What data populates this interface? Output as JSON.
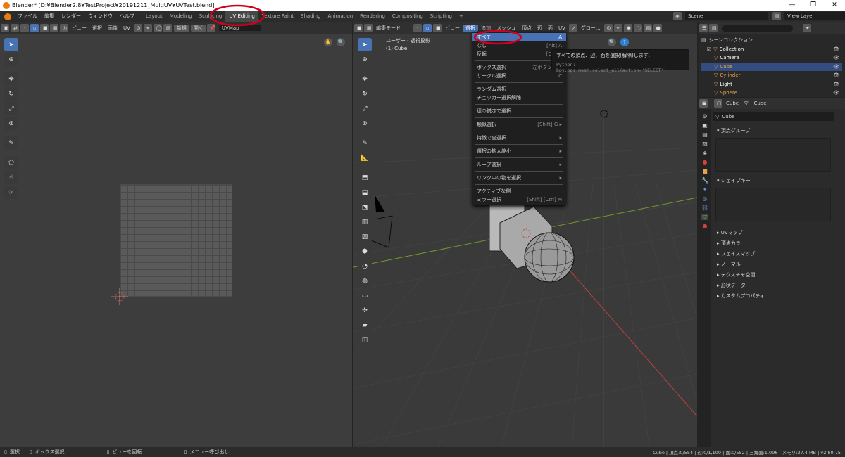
{
  "titlebar": {
    "title": "Blender* [D:¥Blender2.8¥TestProject¥20191211_MultiUV¥UVTest.blend]",
    "minimize": "—",
    "maximize": "❐",
    "close": "✕"
  },
  "top_menu": [
    "ファイル",
    "編集",
    "レンダー",
    "ウィンドウ",
    "ヘルプ"
  ],
  "workspaces": [
    {
      "label": "Layout",
      "active": false
    },
    {
      "label": "Modeling",
      "active": false
    },
    {
      "label": "Sculpting",
      "active": false
    },
    {
      "label": "UV Editing",
      "active": true
    },
    {
      "label": "Texture Paint",
      "active": false
    },
    {
      "label": "Shading",
      "active": false
    },
    {
      "label": "Animation",
      "active": false
    },
    {
      "label": "Rendering",
      "active": false
    },
    {
      "label": "Compositing",
      "active": false
    },
    {
      "label": "Scripting",
      "active": false
    }
  ],
  "add_workspace": "+",
  "scene": {
    "scene_label": "Scene",
    "view_layer_label": "View Layer"
  },
  "uv_editor": {
    "menus": [
      "ビュー",
      "選択",
      "画像",
      "UV"
    ],
    "new_label": "新規",
    "open_label": "開く",
    "uvmap": "UVMap"
  },
  "viewport": {
    "mode": "編集モード",
    "menus": [
      "ビュー",
      "選択",
      "追加",
      "メッシュ",
      "頂点",
      "辺",
      "面",
      "UV"
    ],
    "orientation": "グロー...",
    "view_label": "ユーザー・透視投影",
    "object_label": "(1) Cube"
  },
  "select_menu": {
    "items": [
      {
        "label": "すべて",
        "shortcut": "A",
        "highlight": true
      },
      {
        "label": "なし",
        "shortcut": "[Alt] A"
      },
      {
        "label": "反転",
        "shortcut": "[Ctrl] I"
      },
      {
        "sep": true
      },
      {
        "label": "ボックス選択",
        "shortcut": "左ボタンを..."
      },
      {
        "label": "サークル選択",
        "shortcut": "C"
      },
      {
        "sep": true
      },
      {
        "label": "ランダム選択",
        "shortcut": ""
      },
      {
        "label": "チェッカー選択解除",
        "shortcut": ""
      },
      {
        "sep": true
      },
      {
        "label": "辺の鋭さで選択",
        "shortcut": ""
      },
      {
        "sep": true
      },
      {
        "label": "類似選択",
        "shortcut": "[Shift] G ▸"
      },
      {
        "sep": true
      },
      {
        "label": "特徴で全選択",
        "shortcut": "▸"
      },
      {
        "sep": true
      },
      {
        "label": "選択の拡大縮小",
        "shortcut": "▸"
      },
      {
        "sep": true
      },
      {
        "label": "ループ選択",
        "shortcut": "▸"
      },
      {
        "sep": true
      },
      {
        "label": "リンク中の物を選択",
        "shortcut": "▸"
      },
      {
        "sep": true
      },
      {
        "label": "アクティブな側",
        "shortcut": ""
      },
      {
        "label": "ミラー選択",
        "shortcut": "[Shift] [Ctrl] M"
      }
    ]
  },
  "tooltip": {
    "text": "すべての頂点、辺、面を選択(解除)します.",
    "python": "Python: bpy.ops.mesh.select_all(action='SELECT')"
  },
  "outliner": {
    "header": "シーンコレクション",
    "items": [
      {
        "label": "Collection",
        "color": "#ffffff",
        "indent": 0
      },
      {
        "label": "Camera",
        "color": "#ffffff",
        "indent": 1
      },
      {
        "label": "Cube",
        "color": "#e8a14a",
        "indent": 1
      },
      {
        "label": "Cylinder",
        "color": "#e8a14a",
        "indent": 1
      },
      {
        "label": "Light",
        "color": "#ffffff",
        "indent": 1
      },
      {
        "label": "Sphere",
        "color": "#e8a14a",
        "indent": 1
      }
    ]
  },
  "properties": {
    "object_name": "Cube",
    "mesh_name": "Cube",
    "data_name": "Cube",
    "panels": {
      "vertex_groups": "頂点グループ",
      "shape_keys": "シェイプキー"
    },
    "collapsed": [
      "UVマップ",
      "頂点カラー",
      "フェイスマップ",
      "ノーマル",
      "テクスチャ空間",
      "形状データ",
      "カスタムプロパティ"
    ]
  },
  "status": {
    "select": "選択",
    "box_select": "ボックス選択",
    "rotate_view": "ビューを回転",
    "call_menu": "メニュー呼び出し",
    "stats": "Cube | 頂点:0/554 | 辺:0/1,100 | 面:0/552 | 三角面:1,096 | メモリ:37.4 MB | v2.80.75"
  },
  "colors": {
    "accent": "#4772b3",
    "annotation": "#d0021b",
    "x_axis": "#c04040",
    "y_axis": "#6f9a2a"
  }
}
